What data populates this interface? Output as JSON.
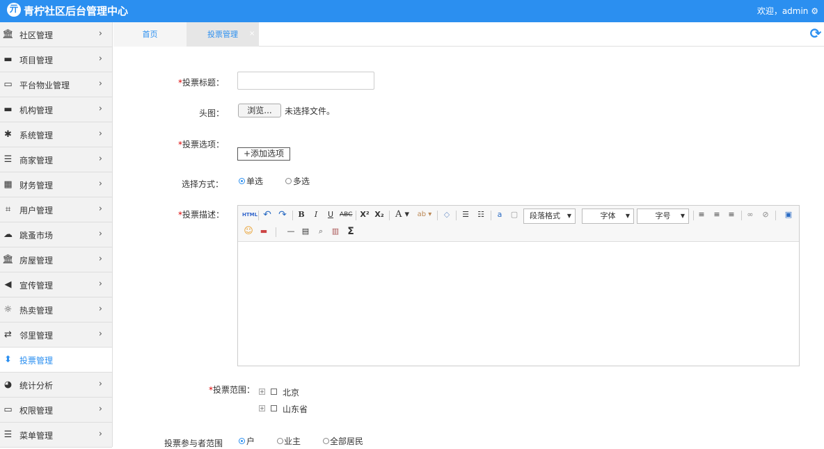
{
  "header": {
    "logo_glyph": "亓",
    "title": "青柠社区后台管理中心",
    "welcome": "欢迎，admin ⚙"
  },
  "sidebar": {
    "items": [
      {
        "label": "社区管理",
        "icon": "bank-icon",
        "glyph": "🏛"
      },
      {
        "label": "项目管理",
        "icon": "discover-card-icon",
        "glyph": "▬"
      },
      {
        "label": "平台物业管理",
        "icon": "monitor-icon",
        "glyph": "▭"
      },
      {
        "label": "机构管理",
        "icon": "stripe-icon",
        "glyph": "▬"
      },
      {
        "label": "系统管理",
        "icon": "pinwheel-icon",
        "glyph": "✱"
      },
      {
        "label": "商家管理",
        "icon": "menu-lines-icon",
        "glyph": "☰"
      },
      {
        "label": "财务管理",
        "icon": "calculator-icon",
        "glyph": "▦"
      },
      {
        "label": "用户管理",
        "icon": "crop-icon",
        "glyph": "⌗"
      },
      {
        "label": "跳蚤市场",
        "icon": "cloud-icon",
        "glyph": "☁"
      },
      {
        "label": "房屋管理",
        "icon": "bank-icon",
        "glyph": "🏛"
      },
      {
        "label": "宣传管理",
        "icon": "volume-icon",
        "glyph": "◀"
      },
      {
        "label": "热卖管理",
        "icon": "sun-icon",
        "glyph": "☼"
      },
      {
        "label": "邻里管理",
        "icon": "retweet-icon",
        "glyph": "⇄"
      },
      {
        "label": "投票管理",
        "icon": "sort-icon",
        "glyph": "⬍",
        "active": true
      },
      {
        "label": "统计分析",
        "icon": "pie-chart-icon",
        "glyph": "◕"
      },
      {
        "label": "权限管理",
        "icon": "monitor-icon",
        "glyph": "▭"
      },
      {
        "label": "菜单管理",
        "icon": "list-icon",
        "glyph": "☰"
      }
    ]
  },
  "tabs": [
    {
      "label": "首页"
    },
    {
      "label": "投票管理"
    }
  ],
  "tab_close": "×",
  "refresh_glyph": "⟳",
  "form": {
    "required_mark": "*",
    "title_label": "投票标题：",
    "head_image_label": "头图：",
    "browse_label": "浏览...",
    "no_file_text": "未选择文件。",
    "options_label": "投票选项：",
    "add_option_label": "+添加选项",
    "mode_label": "选择方式：",
    "mode_options": [
      "单选",
      "多选"
    ],
    "desc_label": "投票描述：",
    "scope_label": "投票范围：",
    "scope_nodes": [
      "北京",
      "山东省"
    ],
    "participant_label": "投票参与者范围",
    "participant_options": [
      "户",
      "业主",
      "全部居民"
    ]
  },
  "editor": {
    "paragraph_format": "段落格式",
    "font_family": "字体",
    "font_size": "字号"
  }
}
